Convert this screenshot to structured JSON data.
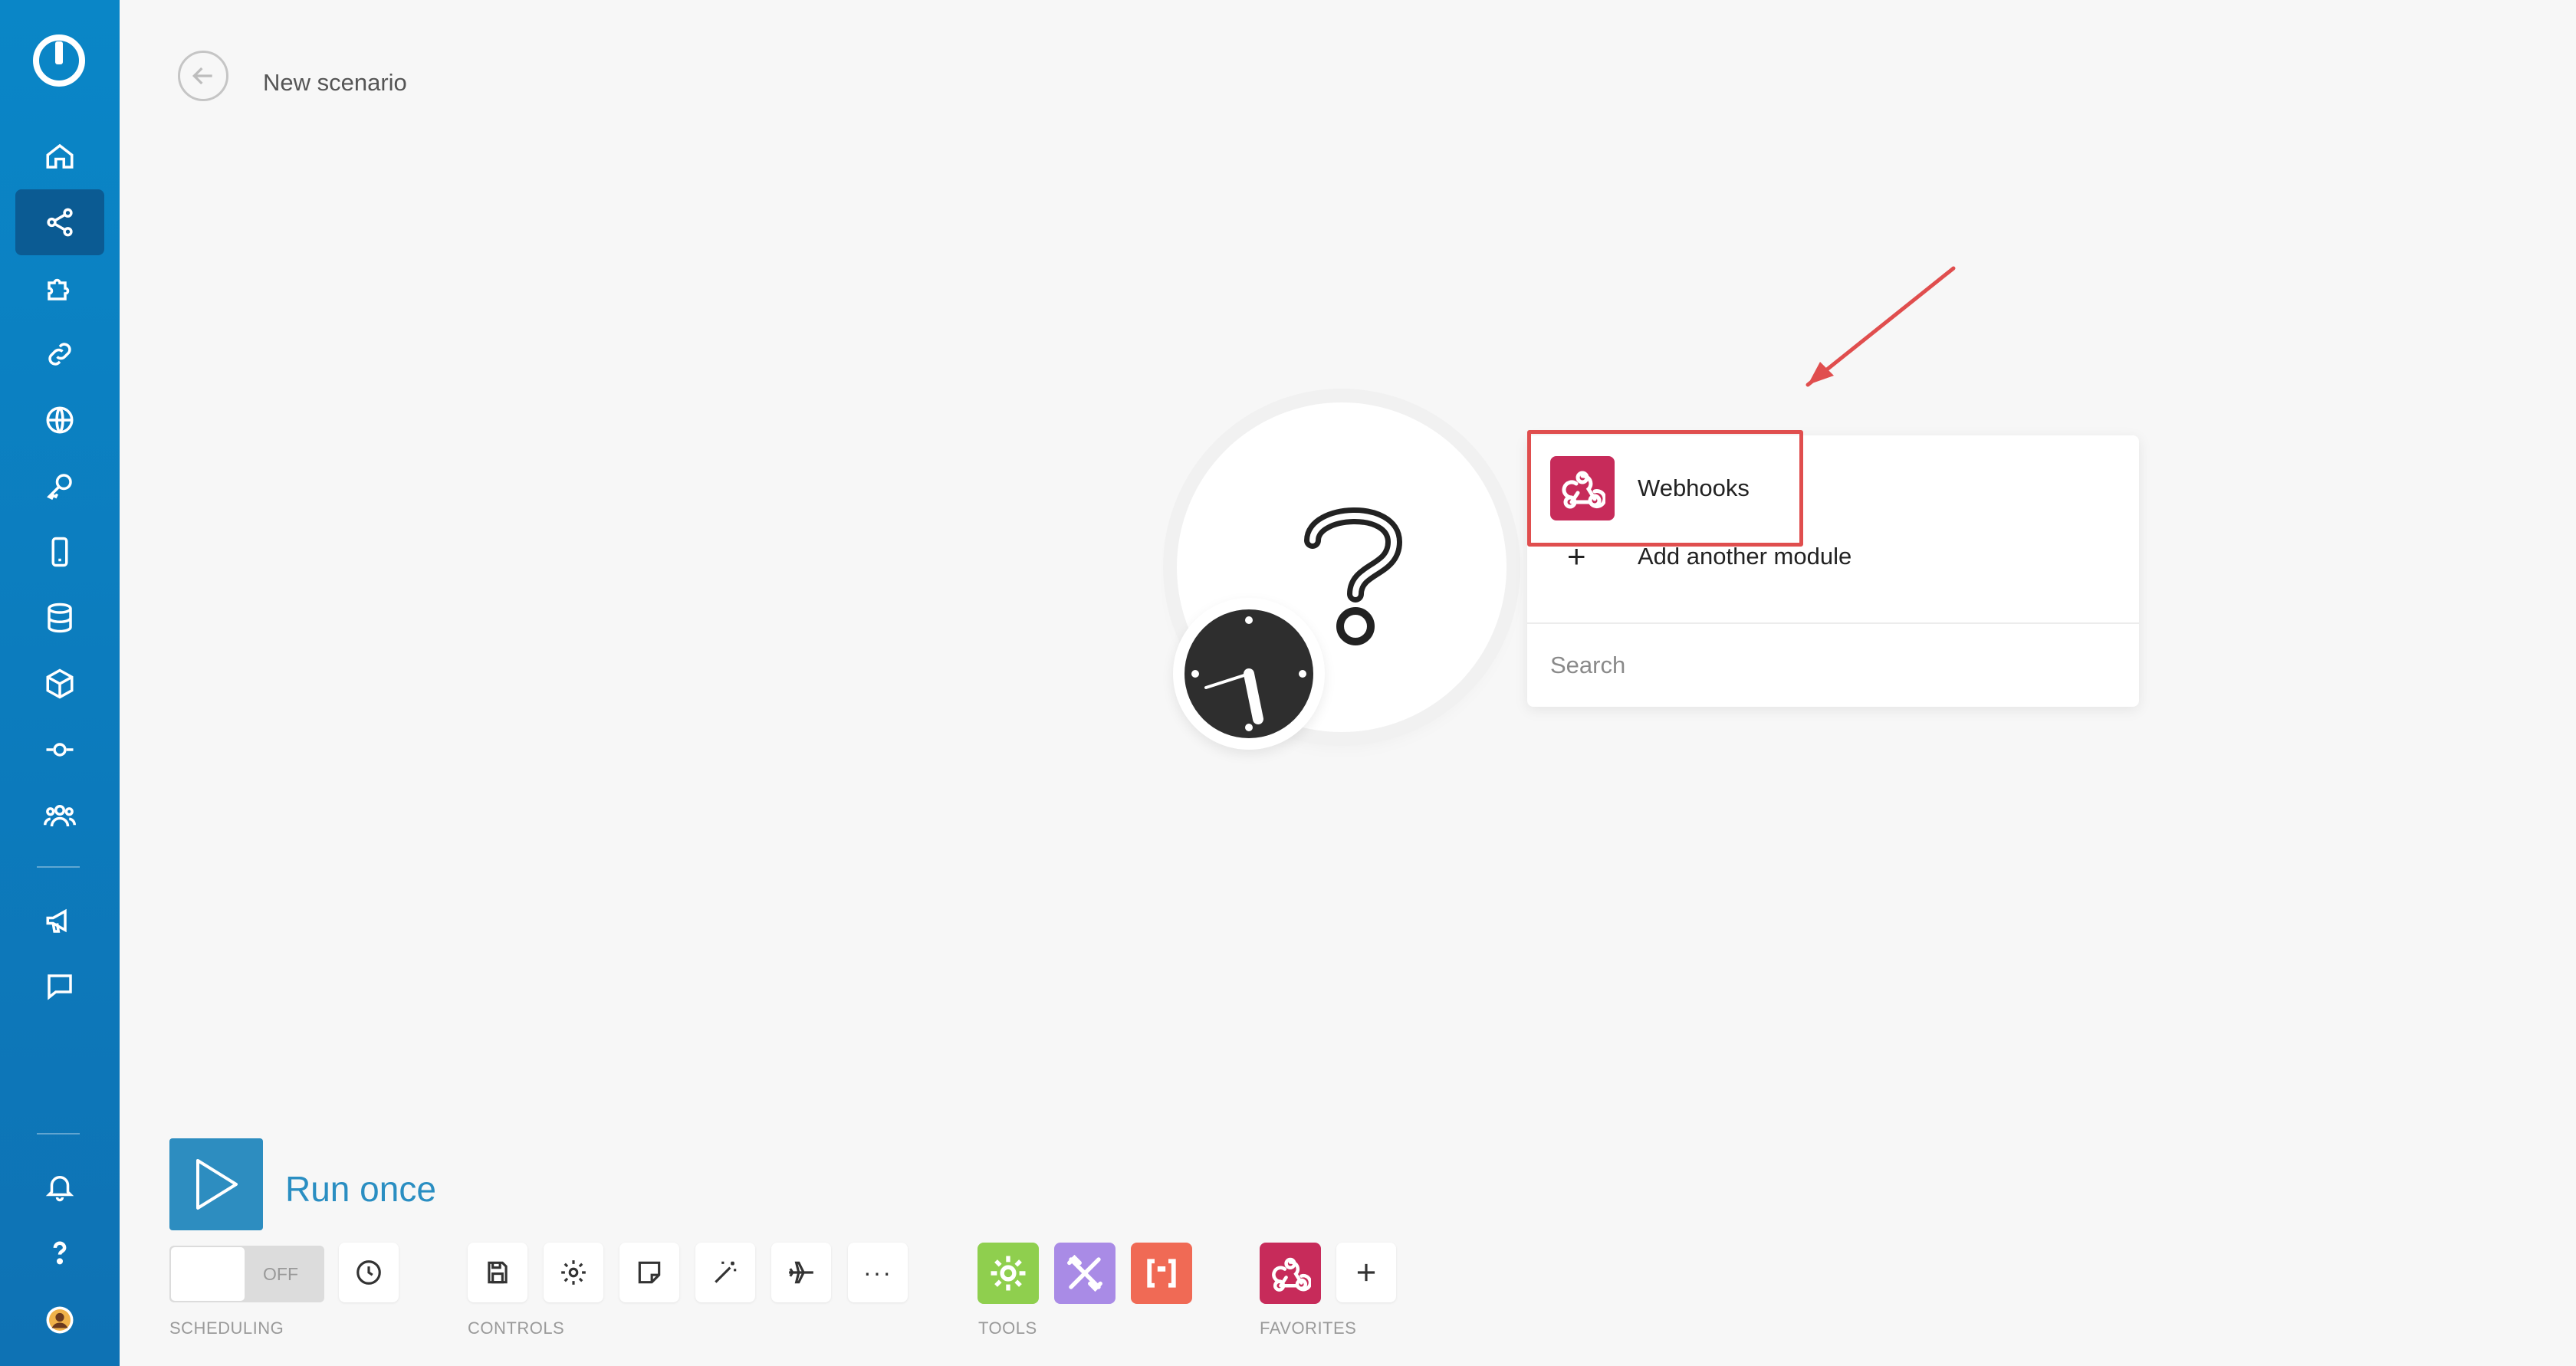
{
  "header": {
    "title": "New scenario"
  },
  "sidebar": {
    "items": [
      {
        "icon": "home-icon"
      },
      {
        "icon": "share-icon",
        "active": true
      },
      {
        "icon": "puzzle-icon"
      },
      {
        "icon": "link-icon"
      },
      {
        "icon": "globe-icon"
      },
      {
        "icon": "key-icon"
      },
      {
        "icon": "device-icon"
      },
      {
        "icon": "database-icon"
      },
      {
        "icon": "box-icon"
      },
      {
        "icon": "flow-icon"
      },
      {
        "icon": "team-icon"
      },
      {
        "icon": "megaphone-icon"
      },
      {
        "icon": "chat-icon"
      },
      {
        "icon": "bell-icon"
      },
      {
        "icon": "help-icon"
      },
      {
        "icon": "avatar"
      }
    ]
  },
  "dropdown": {
    "webhooks_label": "Webhooks",
    "add_label": "Add another module",
    "search_placeholder": "Search"
  },
  "bottom": {
    "run_label": "Run once",
    "toggle_state": "OFF",
    "scheduling_label": "SCHEDULING",
    "controls_label": "CONTROLS",
    "tools_label": "TOOLS",
    "favorites_label": "FAVORITES"
  },
  "colors": {
    "sidebar": "#0a86c7",
    "accent": "#2d8dc0",
    "webhooks": "#c72b5a",
    "tools_green": "#8fcf4e",
    "tools_purple": "#a98be6",
    "tools_orange": "#f06a55",
    "highlight": "#e04e4e"
  }
}
